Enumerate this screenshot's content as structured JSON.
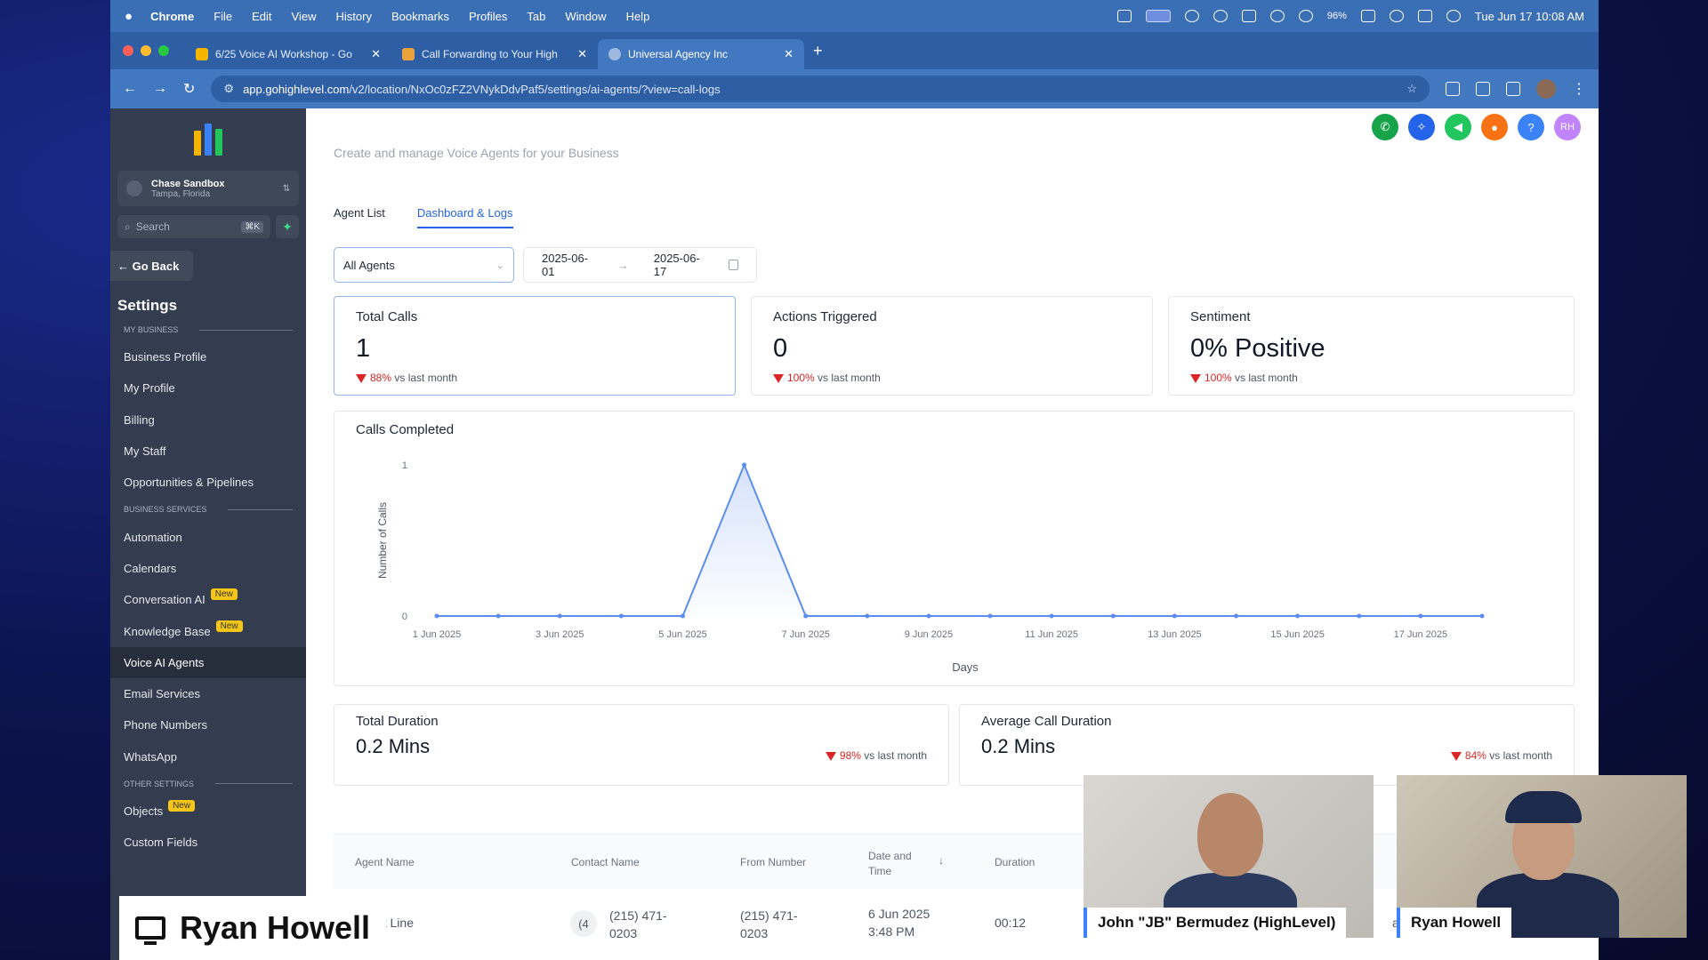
{
  "menubar": {
    "app": "Chrome",
    "items": [
      "File",
      "Edit",
      "View",
      "History",
      "Bookmarks",
      "Profiles",
      "Tab",
      "Window",
      "Help"
    ],
    "battery": "96%",
    "datetime": "Tue Jun 17  10:08 AM"
  },
  "tabs": [
    {
      "title": "6/25 Voice AI Workshop - Go"
    },
    {
      "title": "Call Forwarding to Your High"
    },
    {
      "title": "Universal Agency Inc"
    }
  ],
  "address": {
    "host": "app.gohighlevel.com",
    "path": "/v2/location/NxOc0zFZ2VNykDdvPaf5/settings/ai-agents/?view=call-logs"
  },
  "sidebar": {
    "location_name": "Chase Sandbox",
    "location_sub": "Tampa, Florida",
    "search_placeholder": "Search",
    "search_kbd": "⌘K",
    "go_back": "← Go Back",
    "settings_title": "Settings",
    "sections": [
      {
        "heading": "MY BUSINESS",
        "items": [
          {
            "label": "Business Profile"
          },
          {
            "label": "My Profile"
          },
          {
            "label": "Billing"
          },
          {
            "label": "My Staff"
          },
          {
            "label": "Opportunities & Pipelines"
          }
        ]
      },
      {
        "heading": "BUSINESS SERVICES",
        "items": [
          {
            "label": "Automation"
          },
          {
            "label": "Calendars"
          },
          {
            "label": "Conversation AI",
            "badge": "New"
          },
          {
            "label": "Knowledge Base",
            "badge": "New"
          },
          {
            "label": "Voice AI Agents",
            "active": true
          },
          {
            "label": "Email Services"
          },
          {
            "label": "Phone Numbers"
          },
          {
            "label": "WhatsApp"
          }
        ]
      },
      {
        "heading": "OTHER SETTINGS",
        "items": [
          {
            "label": "Objects",
            "badge": "New"
          },
          {
            "label": "Custom Fields"
          }
        ]
      }
    ]
  },
  "main": {
    "subtitle": "Create and manage Voice Agents for your Business",
    "tabs": [
      "Agent List",
      "Dashboard & Logs"
    ],
    "agent_select": "All Agents",
    "date_from": "2025-06-01",
    "date_to": "2025-06-17",
    "stats": [
      {
        "label": "Total Calls",
        "value": "1",
        "delta": "88%",
        "delta_suffix": "vs last month"
      },
      {
        "label": "Actions Triggered",
        "value": "0",
        "delta": "100%",
        "delta_suffix": "vs last month"
      },
      {
        "label": "Sentiment",
        "value": "0% Positive",
        "delta": "100%",
        "delta_suffix": "vs last month"
      }
    ],
    "durations": [
      {
        "label": "Total Duration",
        "value": "0.2 Mins",
        "delta": "98%",
        "delta_suffix": "vs last month"
      },
      {
        "label": "Average Call Duration",
        "value": "0.2 Mins",
        "delta": "84%",
        "delta_suffix": "vs last month"
      }
    ],
    "table": {
      "headers": [
        "Agent Name",
        "Contact Name",
        "From Number",
        "Date and Time",
        "Duration"
      ],
      "row": {
        "agent": "bing Hot Line",
        "contact_initial": "(4",
        "contact": "(215) 471-0203",
        "from": "(215) 471-0203",
        "date": "6 Jun 2025",
        "time": "3:48 PM",
        "duration": "00:12",
        "extra": "ary"
      }
    }
  },
  "chart_data": {
    "type": "line",
    "title": "Calls Completed",
    "xlabel": "Days",
    "ylabel": "Number of Calls",
    "ylim": [
      0,
      1
    ],
    "yticks": [
      "0",
      "1"
    ],
    "xticks": [
      "1 Jun 2025",
      "3 Jun 2025",
      "5 Jun 2025",
      "7 Jun 2025",
      "9 Jun 2025",
      "11 Jun 2025",
      "13 Jun 2025",
      "15 Jun 2025",
      "17 Jun 2025"
    ],
    "x": [
      "2025-06-01",
      "2025-06-02",
      "2025-06-03",
      "2025-06-04",
      "2025-06-05",
      "2025-06-06",
      "2025-06-07",
      "2025-06-08",
      "2025-06-09",
      "2025-06-10",
      "2025-06-11",
      "2025-06-12",
      "2025-06-13",
      "2025-06-14",
      "2025-06-15",
      "2025-06-16",
      "2025-06-17",
      "2025-06-18"
    ],
    "values": [
      0,
      0,
      0,
      0,
      0,
      1,
      0,
      0,
      0,
      0,
      0,
      0,
      0,
      0,
      0,
      0,
      0,
      0
    ],
    "color": "#5b8def",
    "grid": false
  },
  "overlay": {
    "presenter": "Ryan Howell",
    "cams": [
      {
        "name": "John \"JB\" Bermudez (HighLevel)"
      },
      {
        "name": "Ryan Howell"
      }
    ]
  },
  "colors": {
    "accent": "#2563eb",
    "sidebar": "#333d4f",
    "down": "#dc2626"
  }
}
